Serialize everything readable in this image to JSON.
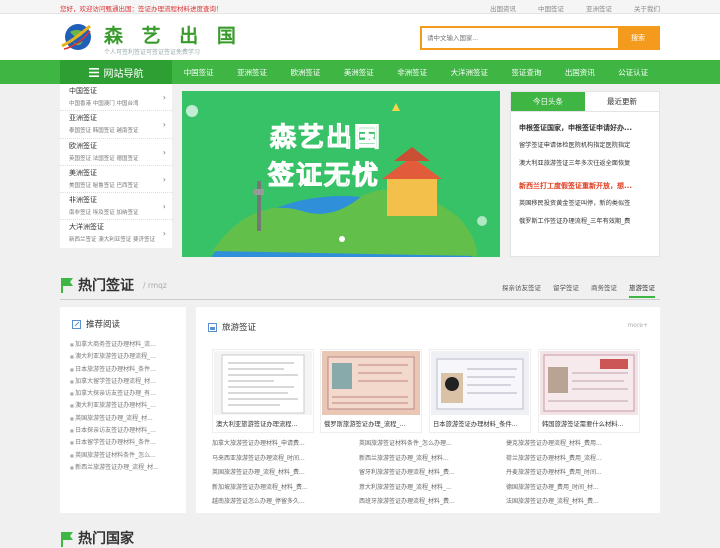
{
  "topbar": {
    "welcome": "您好，欢迎访问甄通出国：签证办理流程材料进度查询！",
    "links": [
      "出国资讯",
      "中国签证",
      "亚洲签证",
      "关于我们"
    ]
  },
  "header": {
    "brand": "森 艺 出 国",
    "slogan": "个人可签利签证可签证签证免费学习",
    "search_placeholder": "请中文输入国家...",
    "search_button": "搜索"
  },
  "nav": {
    "title": "网站导航",
    "items": [
      "中国签证",
      "亚洲签证",
      "欧洲签证",
      "美洲签证",
      "非洲签证",
      "大洋洲签证",
      "签证查询",
      "出国资讯",
      "公证认证"
    ]
  },
  "categories": [
    {
      "title": "中国签证",
      "sub": "中国香港 中国澳门 中国台湾"
    },
    {
      "title": "亚洲签证",
      "sub": "泰国签证 韩国签证 越南签证"
    },
    {
      "title": "欧洲签证",
      "sub": "英国签证 法国签证 德国签证"
    },
    {
      "title": "美洲签证",
      "sub": "美国签证 秘鲁签证 巴西签证"
    },
    {
      "title": "非洲签证",
      "sub": "南非签证 埃及签证 加纳签证"
    },
    {
      "title": "大洋洲签证",
      "sub": "新西兰签证 澳大利亚签证 斐济签证"
    }
  ],
  "banner": {
    "line1": "森艺出国",
    "line2": "签证无忧"
  },
  "news": {
    "tabs": [
      "今日头条",
      "最近更新"
    ],
    "items": [
      {
        "text": "申根签证国家，申根签证申请好办...",
        "style": "bold"
      },
      {
        "text": "留学签证申请体检医院机构指定医院指定",
        "style": "normal"
      },
      {
        "text": "澳大利亚旅游签证三年多次往返全面恢复",
        "style": "normal"
      },
      {
        "text": "新西兰打工度假签证重新开放，想...",
        "style": "red"
      },
      {
        "text": "英国移民投资黄金签证叫停，新的类似签",
        "style": "normal"
      },
      {
        "text": "俄罗斯工作签证办理流程_三年有效期_费",
        "style": "normal"
      }
    ]
  },
  "hot": {
    "title": "热门签证",
    "sub": "/ rmqz",
    "tabs": [
      "探亲访友签证",
      "留学签证",
      "商务签证",
      "旅游签证"
    ]
  },
  "rec": {
    "title": "推荐阅读",
    "items": [
      "加拿大商务签证办理材料_流...",
      "澳大利亚旅游签证办理流程_...",
      "日本旅游签证办理材料_条件...",
      "加拿大留学签证办理流程_材...",
      "加拿大探亲访友签证办理_有...",
      "澳大利亚旅游签证办理材料_...",
      "英国旅游签证办理_流程_材...",
      "日本探亲访友签证办理材料_...",
      "日本留学签证办理材料_条件...",
      "英国旅游签证材料条件_怎么...",
      "新西兰旅游签证办理_流程_材..."
    ]
  },
  "tourism": {
    "title": "旅游签证",
    "more": "more+",
    "cards": [
      "澳大利亚旅游签证办理流程...",
      "俄罗斯旅游签证办理_流程_...",
      "日本旅游签证办理材料_条件...",
      "韩国旅游签证需要什么材料..."
    ],
    "links": [
      "加拿大旅游签证办理材料_申请费...",
      "英国旅游签证材料条件_怎么办理...",
      "捷克旅游签证办理流程_材料_费用...",
      "马来西亚旅游签证办理流程_时间...",
      "新西兰旅游签证办理_流程_材料...",
      "荷兰旅游签证办理材料_费用_流程...",
      "英国旅游签证办理_流程_材料_费...",
      "留牙利旅游签证办理流程_材料_费...",
      "丹麦旅游签证办理材料_费用_时间...",
      "新加坡旅游签证办理流程_材料_费...",
      "意大利旅游签证办理_流程_材料_...",
      "德国旅游签证办理_费用_时间_材...",
      "越南旅游签证怎么办理_停留多久...",
      "西班牙旅游签证办理流程_材料_费...",
      "法国旅游签证办理_流程_材料_费..."
    ]
  },
  "bottom": {
    "title": "热门国家"
  }
}
